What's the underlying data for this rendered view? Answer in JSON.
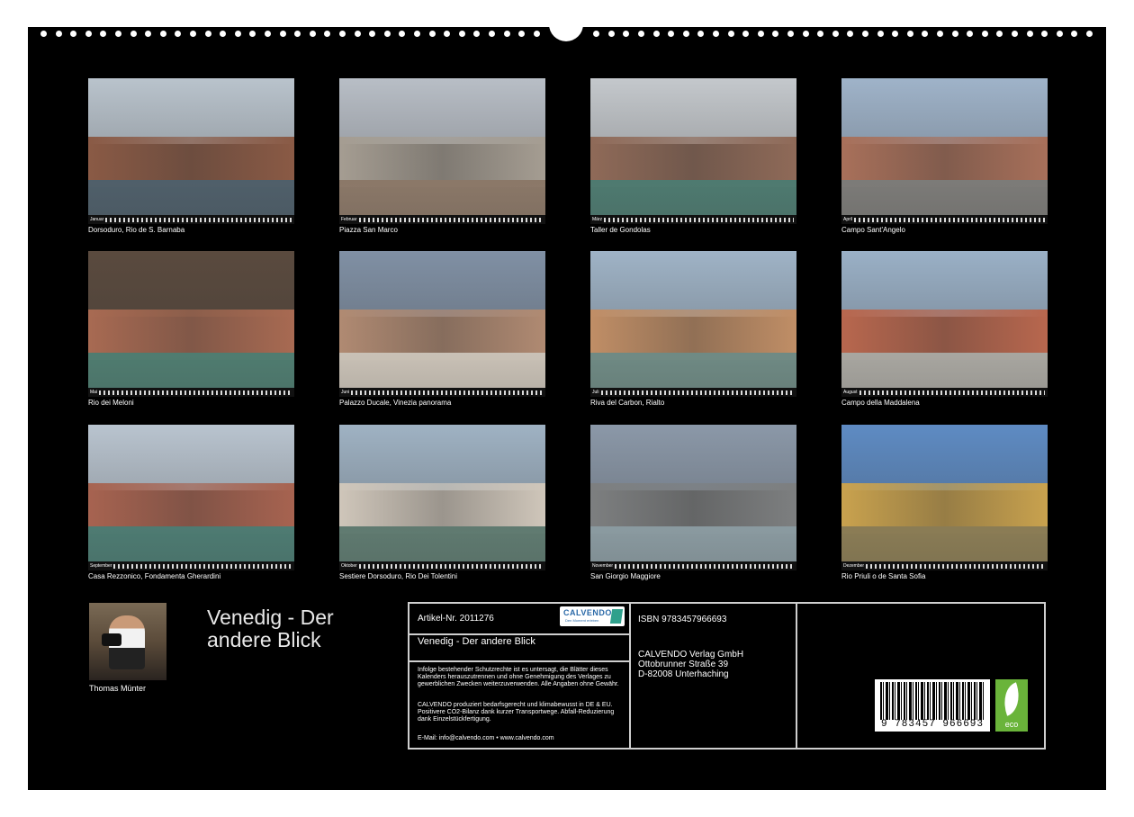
{
  "tiles": [
    {
      "month": "Januar",
      "caption": "Dorsoduro, Rio de S. Barnaba",
      "palette": [
        "#b9c3cc",
        "#8a5a45",
        "#4f5f6a"
      ]
    },
    {
      "month": "Februar",
      "caption": "Piazza San Marco",
      "palette": [
        "#b8bec6",
        "#a59d92",
        "#8b7868"
      ]
    },
    {
      "month": "März",
      "caption": "Taller de Gondolas",
      "palette": [
        "#c4c8cc",
        "#8f6a58",
        "#4e7a70"
      ]
    },
    {
      "month": "April",
      "caption": "Campo Sant'Angelo",
      "palette": [
        "#9fb3c9",
        "#a8705a",
        "#7c7b78"
      ]
    },
    {
      "month": "Mai",
      "caption": "Rio dei Meloni",
      "palette": [
        "#5a4a3e",
        "#a86a52",
        "#4f7c70"
      ]
    },
    {
      "month": "Juni",
      "caption": "Palazzo Ducale, Vinezia panorama",
      "palette": [
        "#8090a4",
        "#b08a72",
        "#c9c1b6"
      ]
    },
    {
      "month": "Juli",
      "caption": "Riva del Carbon, Rialto",
      "palette": [
        "#9fb3c6",
        "#c08e66",
        "#6f8a84"
      ]
    },
    {
      "month": "August",
      "caption": "Campo della Maddalena",
      "palette": [
        "#9ab0c6",
        "#b8674e",
        "#a8a6a0"
      ]
    },
    {
      "month": "September",
      "caption": "Casa Rezzonico, Fondamenta Gherardini",
      "palette": [
        "#b9c4cf",
        "#a76350",
        "#4d7b72"
      ]
    },
    {
      "month": "Oktober",
      "caption": "Sestiere Dorsoduro, Rio Dei Tolentini",
      "palette": [
        "#9fb2c3",
        "#cfc6ba",
        "#5f7a70"
      ]
    },
    {
      "month": "November",
      "caption": "San Giorgio Maggiore",
      "palette": [
        "#8b98a8",
        "#7d7f80",
        "#8a9aa0"
      ]
    },
    {
      "month": "Dezember",
      "caption": "Rio Priuli o de Santa Sofia",
      "palette": [
        "#5e8bc3",
        "#c9a24e",
        "#8a7c55"
      ]
    }
  ],
  "author": {
    "name": "Thomas Münter"
  },
  "calendar_title": "Venedig - Der andere Blick",
  "info": {
    "article_no": "Artikel-Nr. 2011276",
    "logo_word": "CALVENDO",
    "logo_tagline": "Den Moment erleben",
    "product_title": "Venedig - Der andere Blick",
    "legal": "Infolge bestehender Schutzrechte ist es untersagt, die Blätter dieses Kalenders herauszutrennen und ohne Genehmigung des Verlages zu gewerblichen Zwecken weiterzuverwenden. Alle Angaben ohne Gewähr.",
    "eco_note": "CALVENDO produziert bedarfsgerecht und klimabewusst in DE & EU. Positivere CO2-Bilanz dank kurzer Transportwege. Abfall-Reduzierung dank Einzelstückfertigung.",
    "contact": "E-Mail: info@calvendo.com • www.calvendo.com",
    "isbn": "ISBN 9783457966693",
    "publisher_name": "CALVENDO Verlag GmbH",
    "publisher_street": "Ottobrunner Straße 39",
    "publisher_city": "D-82008 Unterhaching",
    "barcode_number": "9 783457 966693",
    "eco_label": "eco"
  }
}
